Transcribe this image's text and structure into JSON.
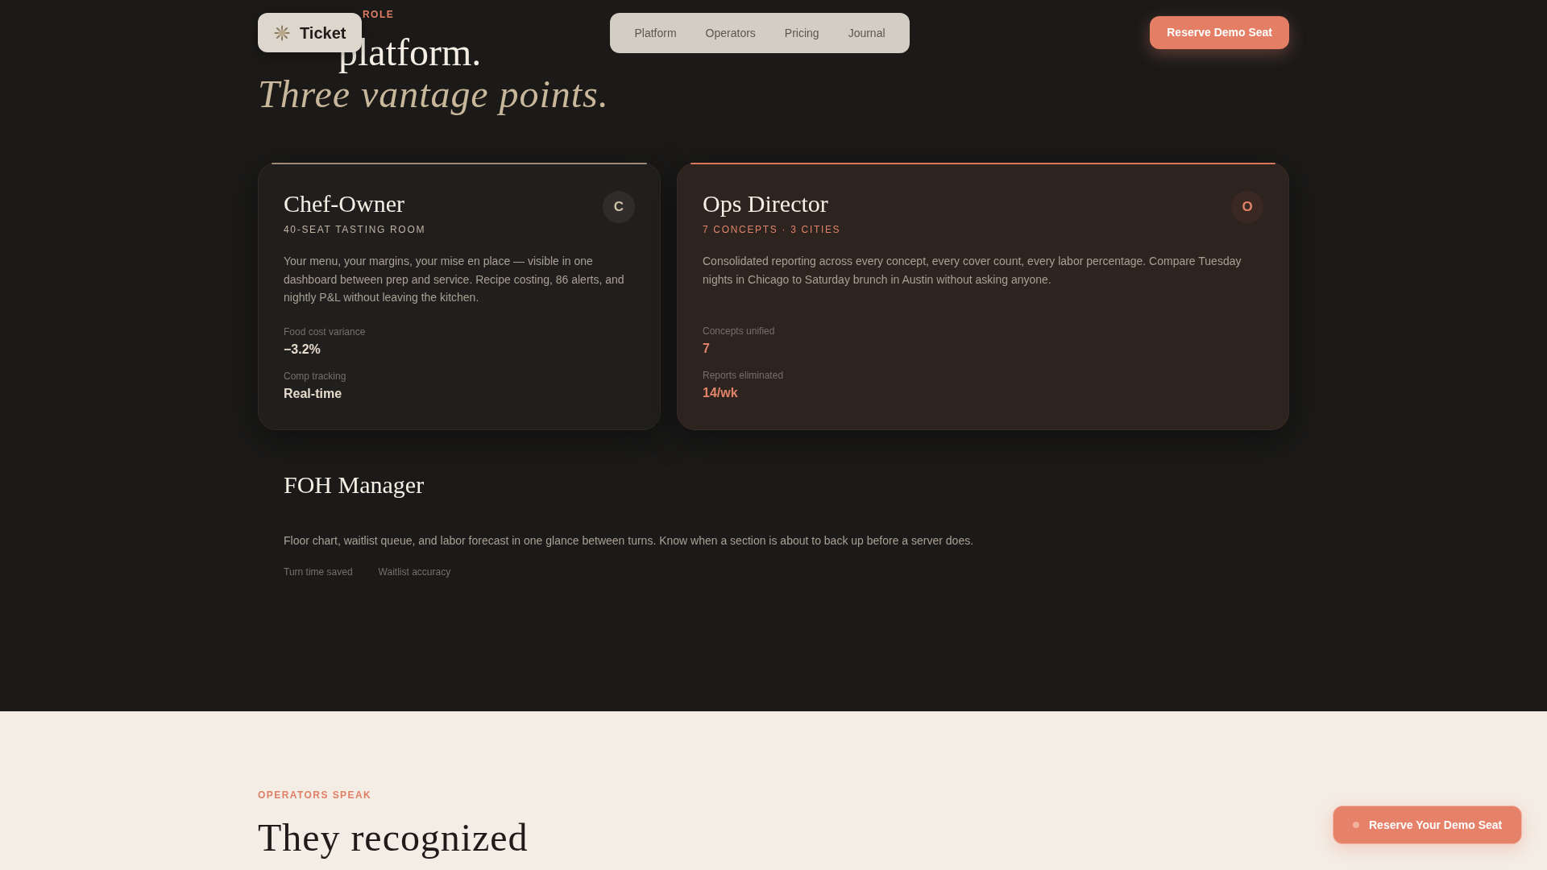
{
  "header": {
    "brand": "Ticket",
    "nav": [
      "Platform",
      "Operators",
      "Pricing",
      "Journal"
    ],
    "cta": "Reserve Demo Seat"
  },
  "roles": {
    "eyebrow": "ROLE",
    "title": "platform.",
    "subtitle": "Three vantage points.",
    "cards": [
      {
        "kind": "standard",
        "title": "Chef-Owner",
        "subtitle": "40-SEAT TASTING ROOM",
        "avatar": "C",
        "text": "Your menu, your margins, your mise en place — visible in one dashboard between prep and service. Recipe costing, 86 alerts, and nightly P&L without leaving the kitchen.",
        "stats": [
          {
            "label": "Food cost variance",
            "value": "−3.2%"
          },
          {
            "label": "Comp tracking",
            "value": "Real-time"
          }
        ]
      },
      {
        "kind": "featured",
        "title": "Ops Director",
        "subtitle": "7 CONCEPTS · 3 CITIES",
        "avatar": "O",
        "text": "Consolidated reporting across every concept, every cover count, every labor percentage. Compare Tuesday nights in Chicago to Saturday brunch in Austin without asking anyone.",
        "stats": [
          {
            "label": "Concepts unified",
            "value": "7"
          },
          {
            "label": "Reports eliminated",
            "value": "14/wk"
          }
        ]
      },
      {
        "kind": "faded",
        "title": "FOH Manager",
        "text": "Floor chart, waitlist queue, and labor forecast in one glance between turns. Know when a section is about to back up before a server does.",
        "stats": [
          {
            "label": "Turn time saved"
          },
          {
            "label": "Waitlist accuracy"
          }
        ]
      }
    ]
  },
  "testimonials": {
    "eyebrow": "OPERATORS SPEAK",
    "title": "They recognized"
  },
  "floating_cta": "Reserve Your Demo Seat"
}
